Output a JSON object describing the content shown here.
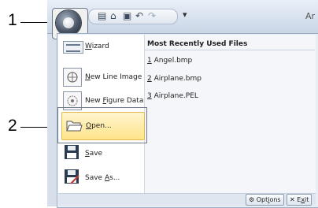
{
  "callouts": {
    "one": "1",
    "two": "2"
  },
  "window": {
    "title_fragment": "Ar",
    "qat_arrow": "▾"
  },
  "menu": {
    "items": [
      {
        "pre": "",
        "acc": "W",
        "post": "izard",
        "icon": "wizard-icon"
      },
      {
        "pre": "",
        "acc": "N",
        "post": "ew Line Image",
        "icon": "new-line-image-icon"
      },
      {
        "pre": "New ",
        "acc": "F",
        "post": "igure Data",
        "icon": "new-figure-data-icon"
      },
      {
        "pre": "",
        "acc": "O",
        "post": "pen...",
        "icon": "open-folder-icon"
      },
      {
        "pre": "",
        "acc": "S",
        "post": "ave",
        "icon": "save-icon"
      },
      {
        "pre": "Save ",
        "acc": "A",
        "post": "s...",
        "icon": "save-as-icon"
      }
    ],
    "mru": {
      "header": "Most Recently Used Files",
      "files": [
        {
          "num": "1",
          "name": " Angel.bmp"
        },
        {
          "num": "2",
          "name": " Airplane.bmp"
        },
        {
          "num": "3",
          "name": " Airplane.PEL"
        }
      ]
    },
    "bottom": {
      "options_pre": "Opt",
      "options_acc": "i",
      "options_post": "ons",
      "exit_pre": "E",
      "exit_acc": "x",
      "exit_post": "it"
    }
  }
}
